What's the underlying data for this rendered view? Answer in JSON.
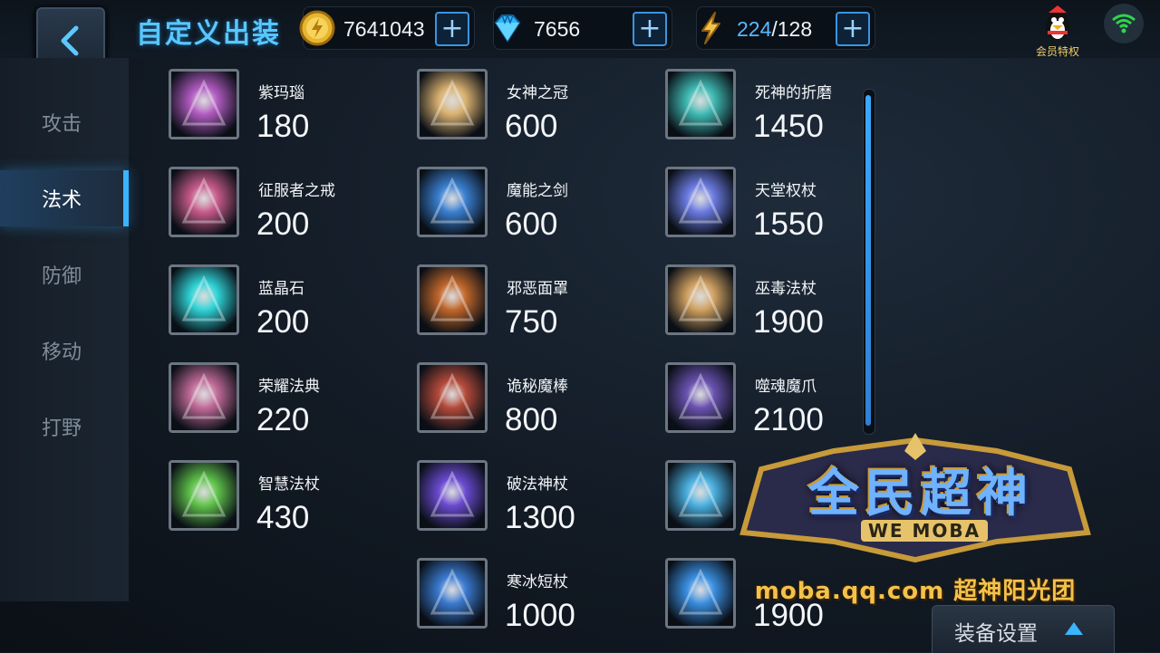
{
  "header": {
    "title": "自定义出装",
    "currencies": [
      {
        "icon": "gold-coin-icon",
        "value": "7641043",
        "add_label": "+"
      },
      {
        "icon": "diamond-icon",
        "value": "7656",
        "add_label": "+"
      },
      {
        "icon": "energy-bolt-icon",
        "value_current": "224",
        "value_max": "/128",
        "add_label": "+"
      }
    ],
    "vip_label": "会员特权"
  },
  "sidebar": {
    "items": [
      {
        "label": "攻击",
        "active": false
      },
      {
        "label": "法术",
        "active": true
      },
      {
        "label": "防御",
        "active": false
      },
      {
        "label": "移动",
        "active": false
      },
      {
        "label": "打野",
        "active": false
      }
    ]
  },
  "items": {
    "col1": [
      {
        "name": "紫玛瑙",
        "price": "180",
        "icon": "purple-orb-icon",
        "color": "#b05ac0"
      },
      {
        "name": "征服者之戒",
        "price": "200",
        "icon": "skull-ring-icon",
        "color": "#c65a8a"
      },
      {
        "name": "蓝晶石",
        "price": "200",
        "icon": "blue-crystal-icon",
        "color": "#2fd3d6"
      },
      {
        "name": "荣耀法典",
        "price": "220",
        "icon": "glory-codex-icon",
        "color": "#c06a98"
      },
      {
        "name": "智慧法杖",
        "price": "430",
        "icon": "wisdom-staff-icon",
        "color": "#5fc24a"
      }
    ],
    "col2": [
      {
        "name": "女神之冠",
        "price": "600",
        "icon": "goddess-crown-icon",
        "color": "#d8b070"
      },
      {
        "name": "魔能之剑",
        "price": "600",
        "icon": "magic-sword-icon",
        "color": "#3a7fd0"
      },
      {
        "name": "邪恶面罩",
        "price": "750",
        "icon": "evil-mask-icon",
        "color": "#c0662a"
      },
      {
        "name": "诡秘魔棒",
        "price": "800",
        "icon": "mystic-wand-icon",
        "color": "#b44a3a"
      },
      {
        "name": "破法神杖",
        "price": "1300",
        "icon": "spellbreaker-staff-icon",
        "color": "#6a4ad0"
      },
      {
        "name": "寒冰短杖",
        "price": "1000",
        "icon": "ice-scepter-icon",
        "color": "#3a7ad0"
      }
    ],
    "col3": [
      {
        "name": "死神的折磨",
        "price": "1450",
        "icon": "death-torment-icon",
        "color": "#3fb9b3"
      },
      {
        "name": "天堂权杖",
        "price": "1550",
        "icon": "heaven-scepter-icon",
        "color": "#6a7ae0"
      },
      {
        "name": "巫毒法杖",
        "price": "1900",
        "icon": "voodoo-staff-icon",
        "color": "#d0a060"
      },
      {
        "name": "噬魂魔爪",
        "price": "2100",
        "icon": "soul-claw-icon",
        "color": "#6a52b0"
      },
      {
        "name": "",
        "price": "",
        "icon": "frost-mask-icon",
        "color": "#4ab0e0"
      },
      {
        "name": "",
        "price": "1900",
        "icon": "ice-staff-icon",
        "color": "#3a8ee0"
      }
    ]
  },
  "logo": {
    "title": "全民超神",
    "subtitle": "WE MOBA",
    "watermark": "moba.qq.com 超神阳光团"
  },
  "footer": {
    "equip_settings_label": "装备设置"
  },
  "colors": {
    "accent": "#3ab4ff",
    "title": "#59c7ff",
    "gold": "#f3c24b"
  }
}
